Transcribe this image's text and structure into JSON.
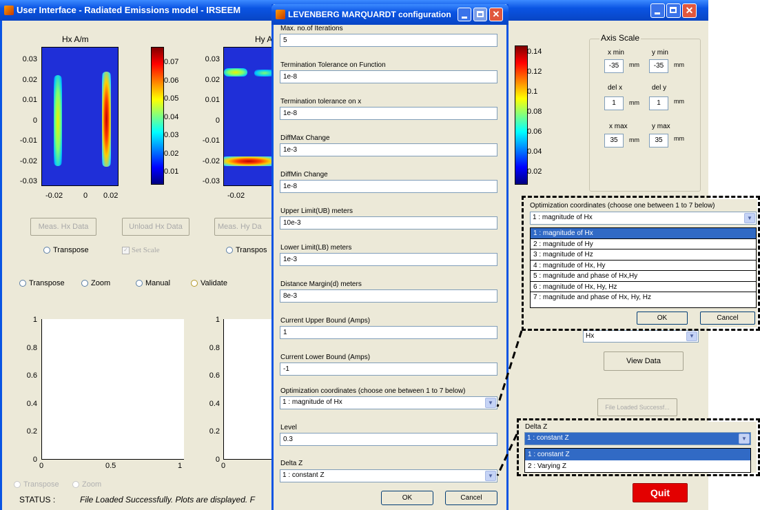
{
  "main_window": {
    "title": "User Interface - Radiated Emissions model - IRSEEM",
    "plot_hx": {
      "title": "Hx A/m",
      "yticks": [
        "0.03",
        "0.02",
        "0.01",
        "0",
        "-0.01",
        "-0.02",
        "-0.03"
      ],
      "xticks": [
        "-0.02",
        "0",
        "0.02"
      ]
    },
    "cbar1_ticks": [
      "0.07",
      "0.06",
      "0.05",
      "0.04",
      "0.03",
      "0.02",
      "0.01"
    ],
    "plot_hy": {
      "title": "Hy A",
      "yticks": [
        "0.03",
        "0.02",
        "0.01",
        "0",
        "-0.01",
        "-0.02",
        "-0.03"
      ],
      "xticks": [
        "-0.02"
      ]
    },
    "cbar2_ticks": [
      "0.14",
      "0.12",
      "0.1",
      "0.08",
      "0.06",
      "0.04",
      "0.02"
    ],
    "buttons": {
      "meas_hx": "Meas. Hx Data",
      "unload_hx": "Unload Hx Data",
      "meas_hy": "Meas. Hy Da",
      "view_data": "View Data",
      "file_loaded": "File Loaded Successf...",
      "quit": "Quit"
    },
    "radios": {
      "transpose1": "Transpose",
      "set_scale": "Set Scale",
      "transpose2": "Transpos",
      "transpose3": "Transpose",
      "zoom": "Zoom",
      "manual": "Manual",
      "validate": "Validate",
      "transpose4": "Transpose",
      "zoom2": "Zoom"
    },
    "bottom_plot1": {
      "yticks": [
        "1",
        "0.8",
        "0.6",
        "0.4",
        "0.2",
        "0"
      ],
      "xticks": [
        "0",
        "0.5",
        "1"
      ]
    },
    "bottom_plot2": {
      "yticks": [
        "1",
        "0.8",
        "0.6",
        "0.4",
        "0.2",
        "0"
      ],
      "xticks": [
        "0"
      ]
    },
    "status_label": "STATUS :",
    "status_text": "File Loaded Successfully. Plots are displayed. F",
    "axis_scale": {
      "title": "Axis Scale",
      "xmin_label": "x min",
      "ymin_label": "y min",
      "xmin": "-35",
      "ymin": "-35",
      "delx_label": "del x",
      "dely_label": "del y",
      "delx": "1",
      "dely": "1",
      "xmax_label": "x max",
      "ymax_label": "y max",
      "xmax": "35",
      "ymax": "35",
      "unit": "mm"
    },
    "hx_select": "Hx"
  },
  "dialog": {
    "title": "LEVENBERG MARQUARDT configuration",
    "fields": [
      {
        "label": "Max. no.of Iterations",
        "value": "5"
      },
      {
        "label": "Termination Tolerance on Function",
        "value": "1e-8"
      },
      {
        "label": "Termination tolerance on x",
        "value": "1e-8"
      },
      {
        "label": "DiffMax Change",
        "value": "1e-3"
      },
      {
        "label": "DiffMin Change",
        "value": "1e-8"
      },
      {
        "label": "Upper Limit(UB) meters",
        "value": "10e-3"
      },
      {
        "label": "Lower Limit(LB) meters",
        "value": "1e-3"
      },
      {
        "label": "Distance Margin(d) meters",
        "value": "8e-3"
      },
      {
        "label": "Current Upper Bound (Amps)",
        "value": "1"
      },
      {
        "label": "Current Lower Bound (Amps)",
        "value": "-1"
      }
    ],
    "opt_label": "Optimization coordinates (choose one between 1 to 7 below)",
    "opt_value": "1 : magnitude of Hx",
    "level_label": "Level",
    "level_value": "0.3",
    "deltaz_label": "Delta Z",
    "deltaz_value": "1 : constant Z",
    "ok": "OK",
    "cancel": "Cancel"
  },
  "opt_popup": {
    "label": "Optimization coordinates (choose one between 1 to 7 below)",
    "selected": "1 : magnitude of Hx",
    "options": [
      "1 : magnitude of Hx",
      "2 : magnitude of Hy",
      "3 : magnitude of Hz",
      "4 : magnitude of Hx, Hy",
      "5 : magnitude and phase of Hx,Hy",
      "6 : magnitude of Hx, Hy, Hz",
      "7 : magnitude and phase of Hx, Hy, Hz"
    ],
    "ok": "OK",
    "cancel": "Cancel"
  },
  "deltaz_popup": {
    "label": "Delta Z",
    "selected": "1 : constant Z",
    "options": [
      "1 : constant Z",
      "2 : Varying Z"
    ]
  },
  "colors": {
    "window_bg": "#ece9d8",
    "title_blue": "#0a54e3",
    "selection": "#316ac5",
    "quit_red": "#e30000"
  },
  "icons": {
    "app": "matlab-icon",
    "minimize": "minimize-icon",
    "maximize": "maximize-icon",
    "close": "close-icon"
  }
}
